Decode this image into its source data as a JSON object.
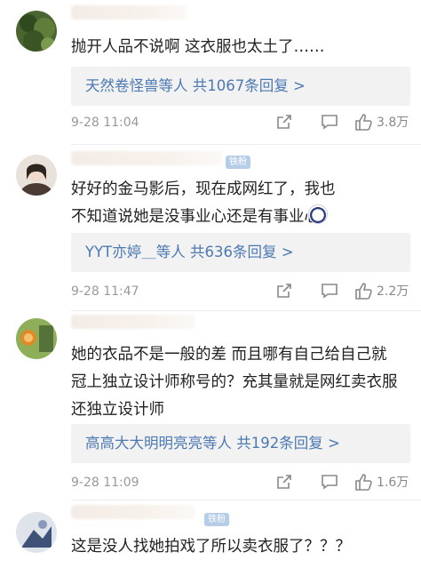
{
  "comments": [
    {
      "text": "抛开人品不说啊 这衣服也太土了……",
      "reply": "天然卷怪兽等人 共1067条回复 >",
      "time": "9-28 11:04",
      "likes": "3.8万",
      "badge": "",
      "avatar_color": "#3f5a2a"
    },
    {
      "text": "好好的金马影后，现在成网红了，我也不知道说她是没事业心还是有事业心",
      "reply": "YYT亦婷＿等人 共636条回复 >",
      "time": "9-28 11:47",
      "likes": "2.2万",
      "badge": "铁粉",
      "avatar_color": "#d8c9bd"
    },
    {
      "text": "她的衣品不是一般的差 而且哪有自己给自己就冠上独立设计师称号的？充其量就是网红卖衣服 还独立设计师",
      "reply": "高高大大明明亮亮等人 共192条回复 >",
      "time": "9-28 11:09",
      "likes": "1.6万",
      "badge": "",
      "avatar_color": "#6e8b3d"
    },
    {
      "text": "这是没人找她拍戏了所以卖衣服了？？？",
      "badge": "铁粉",
      "avatar_color": "#5a6b8a"
    }
  ],
  "icons": {
    "share": "share-icon",
    "comment": "comment-icon",
    "like": "thumbs-up-icon"
  },
  "colors": {
    "link": "#4d79b2",
    "meta": "#999999",
    "badge": "#b6cde8",
    "reply_bg": "#f2f2f2"
  }
}
